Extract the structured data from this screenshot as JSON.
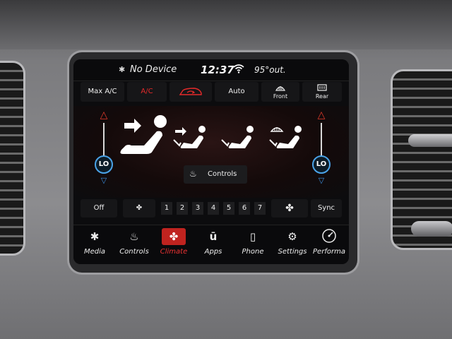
{
  "status_bar": {
    "bluetooth_icon": "bluetooth-icon",
    "device": "No Device",
    "time": "12:37",
    "wifi_icon": "wifi-icon",
    "outside_temp": "95°out."
  },
  "top_row": {
    "max_ac": "Max A/C",
    "ac": "A/C",
    "recirc_icon": "recirculation-icon",
    "auto": "Auto",
    "front_defrost": "Front",
    "rear_defrost": "Rear"
  },
  "climate": {
    "driver_temp": "LO",
    "passenger_temp": "LO",
    "controls_label": "Controls"
  },
  "fan": {
    "off_label": "Off",
    "speeds": [
      "1",
      "2",
      "3",
      "4",
      "5",
      "6",
      "7"
    ],
    "active_speed": "7",
    "sync_label": "Sync"
  },
  "nav": {
    "items": [
      {
        "label": "Media",
        "icon": "bluetooth-icon"
      },
      {
        "label": "Controls",
        "icon": "seat-controls-icon"
      },
      {
        "label": "Climate",
        "icon": "climate-icon",
        "active": true
      },
      {
        "label": "Apps",
        "icon": "apps-icon"
      },
      {
        "label": "Phone",
        "icon": "phone-icon"
      },
      {
        "label": "Settings",
        "icon": "gear-icon"
      },
      {
        "label": "Performa",
        "icon": "gauge-icon"
      }
    ]
  },
  "colors": {
    "accent_red": "#e52a2a",
    "accent_blue": "#3b8fe0"
  }
}
